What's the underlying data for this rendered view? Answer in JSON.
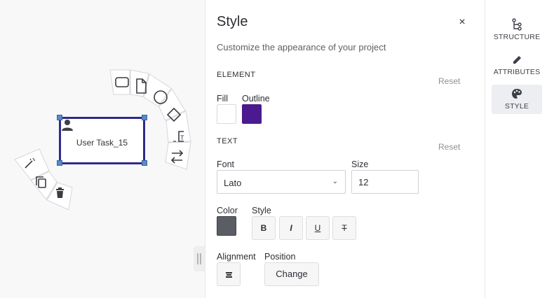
{
  "canvas": {
    "task_label": "User Task_15",
    "context_pad": [
      "task-shape-icon",
      "document-shape-icon",
      "circle-shape-icon",
      "diamond-shape-icon",
      "text-annotation-icon",
      "swap-icon",
      "magic-wand-icon",
      "copy-icon",
      "trash-icon"
    ]
  },
  "style_panel": {
    "title": "Style",
    "close": "×",
    "description": "Customize the appearance of your project",
    "element": {
      "heading": "ELEMENT",
      "reset": "Reset",
      "fill_label": "Fill",
      "outline_label": "Outline",
      "fill_color": "#ffffff",
      "outline_color": "#4b1a8f"
    },
    "text": {
      "heading": "TEXT",
      "reset": "Reset",
      "font_label": "Font",
      "font_value": "Lato",
      "size_label": "Size",
      "size_value": "12",
      "color_label": "Color",
      "text_color": "#5a5d63",
      "style_label": "Style",
      "bold": "B",
      "italic": "I",
      "underline": "U",
      "strike": "T",
      "alignment_label": "Alignment",
      "position_label": "Position",
      "change_button": "Change"
    }
  },
  "side_nav": {
    "items": [
      {
        "label": "STRUCTURE",
        "icon": "structure-icon"
      },
      {
        "label": "ATTRIBUTES",
        "icon": "pencil-icon"
      },
      {
        "label": "STYLE",
        "icon": "palette-icon",
        "active": true
      }
    ]
  }
}
